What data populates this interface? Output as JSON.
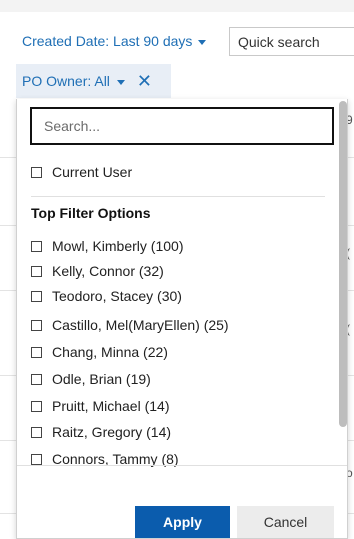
{
  "filters": {
    "created_date_label": "Created Date: Last 90 days",
    "quick_search_placeholder": "Quick search",
    "po_owner_label": "PO Owner: All",
    "po_owner_close": "✕"
  },
  "background_chars": [
    "9",
    "(",
    "(",
    "o"
  ],
  "dropdown": {
    "search_placeholder": "Search...",
    "current_user_label": "Current User",
    "section_title": "Top Filter Options",
    "options": [
      "Mowl, Kimberly (100)",
      "Kelly, Connor (32)",
      "Teodoro, Stacey (30)",
      "Castillo, Mel(MaryEllen) (25)",
      "Chang, Minna (22)",
      "Odle, Brian (19)",
      "Pruitt, Michael (14)",
      "Raitz, Gregory (14)",
      "Connors, Tammy (8)"
    ],
    "apply_label": "Apply",
    "cancel_label": "Cancel"
  },
  "colors": {
    "link_blue": "#1f6fb5",
    "chip_bg": "#e8eef6",
    "apply_bg": "#0b5cad",
    "cancel_bg": "#ececec"
  }
}
